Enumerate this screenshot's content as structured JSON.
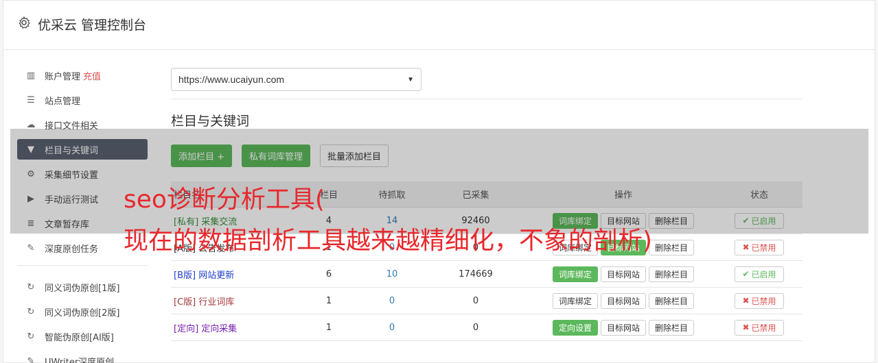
{
  "header": {
    "title": "优采云 管理控制台"
  },
  "sidebar": {
    "items": [
      {
        "label": "账户管理",
        "extra": "充值",
        "icon": "bar-chart-icon"
      },
      {
        "label": "站点管理",
        "icon": "server-icon"
      },
      {
        "label": "接口文件相关",
        "icon": "cloud-upload-icon"
      },
      {
        "label": "栏目与关键词",
        "icon": "filter-icon",
        "active": true
      },
      {
        "label": "采集细节设置",
        "icon": "cogs-icon"
      },
      {
        "label": "手动运行测试",
        "icon": "play-circle-icon"
      },
      {
        "label": "文章暂存库",
        "icon": "database-icon"
      },
      {
        "label": "深度原创任务",
        "icon": "edit-icon"
      }
    ],
    "items2": [
      {
        "label": "同义词伪原创[1版]",
        "icon": "refresh-icon"
      },
      {
        "label": "同义词伪原创[2版]",
        "icon": "refresh-icon"
      },
      {
        "label": "智能伪原创[AI版]",
        "icon": "refresh-icon"
      },
      {
        "label": "UWriter深度原创",
        "icon": "edit-icon"
      }
    ]
  },
  "main": {
    "site_select": "https://www.ucaiyun.com",
    "section_title": "栏目与关键词",
    "buttons": {
      "add": "添加栏目 +",
      "private": "私有词库管理",
      "batch": "批量添加栏目"
    },
    "table": {
      "headers": {
        "name": "栏目名",
        "count": "栏目",
        "pending": "待抓取",
        "collected": "已采集",
        "ops": "操作",
        "status": "状态"
      },
      "rows": [
        {
          "tag": "[私有]",
          "name": "采集交流",
          "count": "4",
          "pending": "14",
          "collected": "92460",
          "op1": "词库绑定",
          "op1_green": true,
          "op2": "目标网站",
          "op3": "删除栏目",
          "status": "已启用",
          "on": true,
          "color": "#3c8d3c"
        },
        {
          "tag": "[A版]",
          "name": "公告发布",
          "count": "1",
          "pending": "0",
          "collected": "0",
          "op1": "词库绑定",
          "op1_green": false,
          "op2": "目标网站",
          "op2_green": true,
          "op3": "删除栏目",
          "status": "已禁用",
          "on": false,
          "color": "#333333"
        },
        {
          "tag": "[B版]",
          "name": "网站更新",
          "count": "6",
          "pending": "10",
          "collected": "174669",
          "op1": "词库绑定",
          "op1_green": true,
          "op2": "目标网站",
          "op3": "删除栏目",
          "status": "已启用",
          "on": true,
          "color": "#1f3ec9"
        },
        {
          "tag": "[C版]",
          "name": "行业词库",
          "count": "1",
          "pending": "0",
          "collected": "0",
          "op1": "词库绑定",
          "op1_green": false,
          "op2": "目标网站",
          "op3": "删除栏目",
          "status": "已禁用",
          "on": false,
          "color": "#a33a3a"
        },
        {
          "tag": "[定向]",
          "name": "定向采集",
          "count": "1",
          "pending": "0",
          "collected": "0",
          "op1": "定向设置",
          "op1_green": true,
          "op2": "目标网站",
          "op3": "删除栏目",
          "status": "已禁用",
          "on": false,
          "color": "#7a1fb0"
        }
      ]
    }
  },
  "overlay": {
    "line1": "seo诊断分析工具(",
    "line2": "现在的数据剖析工具越来越精细化，不象的剖析)"
  },
  "colors": {
    "accent_green": "#5cb85c",
    "danger": "#d9534f",
    "active_nav": "#5a6171",
    "overlay_text": "#e8282d"
  }
}
